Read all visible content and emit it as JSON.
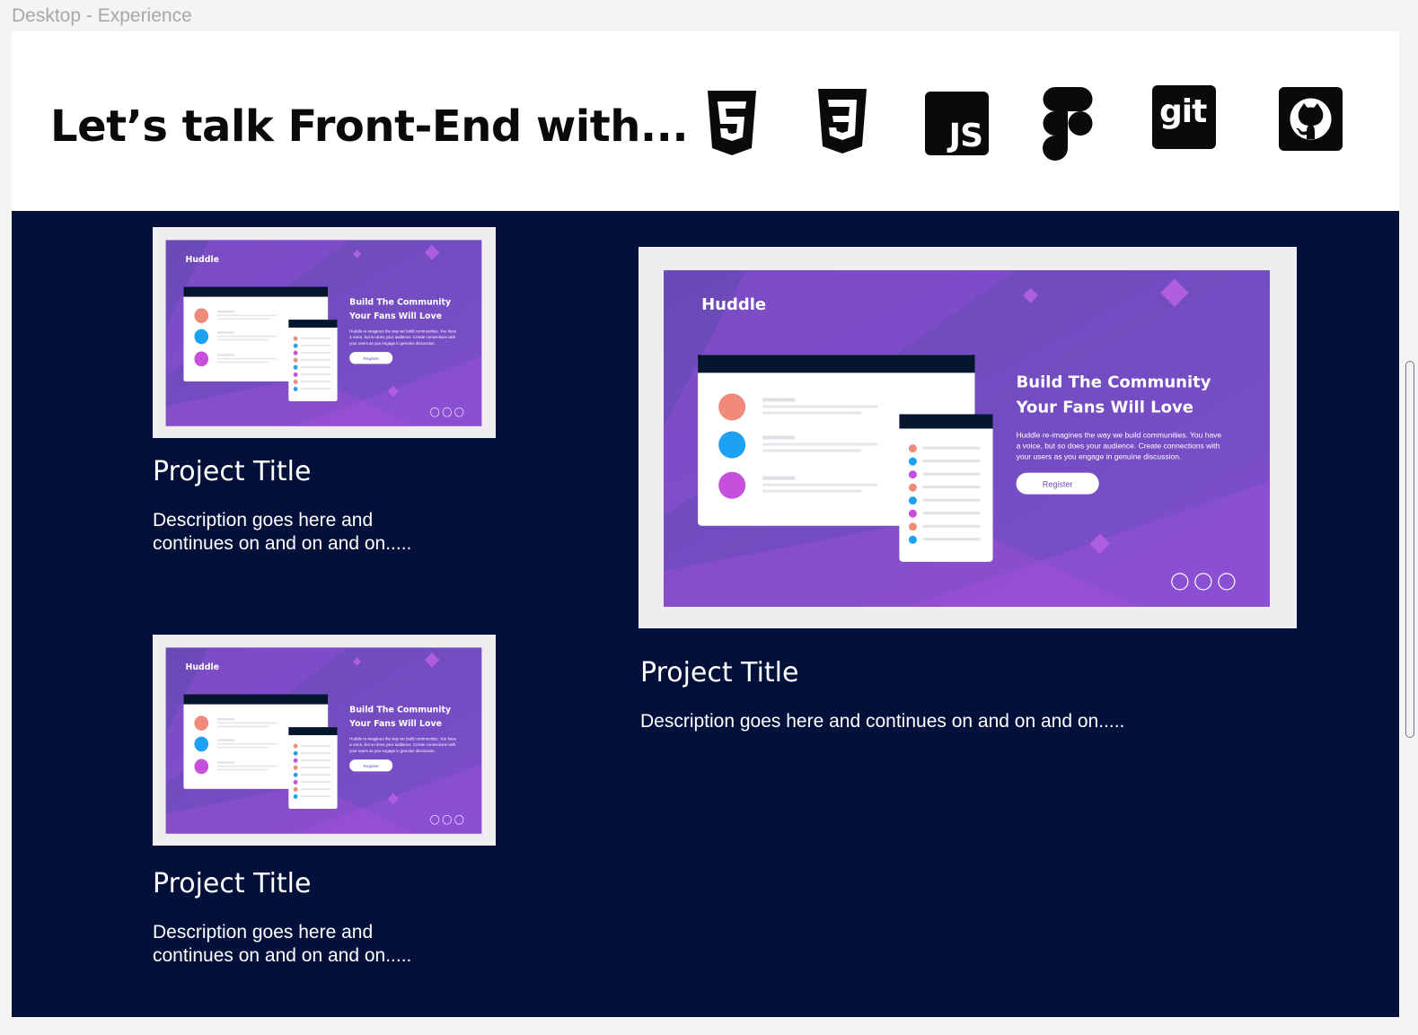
{
  "frame": {
    "label": "Desktop - Experience"
  },
  "header": {
    "title": "Let’s talk Front-End with...",
    "icons": [
      "html5-icon",
      "css3-icon",
      "javascript-icon",
      "figma-icon",
      "git-icon",
      "github-icon"
    ],
    "js_label": "JS",
    "git_label": "git"
  },
  "projects": [
    {
      "title": "Project Title",
      "description": "Description goes here and continues on and on and on.....",
      "preview": {
        "brand": "Huddle",
        "headline_line1": "Build The Community",
        "headline_line2": "Your Fans Will Love",
        "body_line1": "Huddle re-imagines the way we build communities. You have",
        "body_line2": "a voice, but so does your audience. Create connections with",
        "body_line3": "your users as you engage in genuine discussion.",
        "button": "Register"
      }
    },
    {
      "title": "Project Title",
      "description": "Description goes here and continues on and on and on.....",
      "preview": {
        "brand": "Huddle",
        "headline_line1": "Build The Community",
        "headline_line2": "Your Fans Will Love",
        "body_line1": "Huddle re-imagines the way we build communities. You have",
        "body_line2": "a voice, but so does your audience. Create connections with",
        "body_line3": "your users as you engage in genuine discussion.",
        "button": "Register"
      }
    },
    {
      "title": "Project Title",
      "description": "Description goes here and continues on and on and on.....",
      "preview": {
        "brand": "Huddle",
        "headline_line1": "Build The Community",
        "headline_line2": "Your Fans Will Love",
        "body_line1": "Huddle re-imagines the way we build communities. You have",
        "body_line2": "a voice, but so does your audience. Create connections with",
        "body_line3": "your users as you engage in genuine discussion.",
        "button": "Register"
      }
    }
  ],
  "colors": {
    "background": "#f4f4f4",
    "header_band": "#ffffff",
    "content_bg": "#03103a",
    "preview_purple": "#6c4cb8",
    "preview_magenta": "#b04bd6",
    "text_light": "#ffffff"
  }
}
